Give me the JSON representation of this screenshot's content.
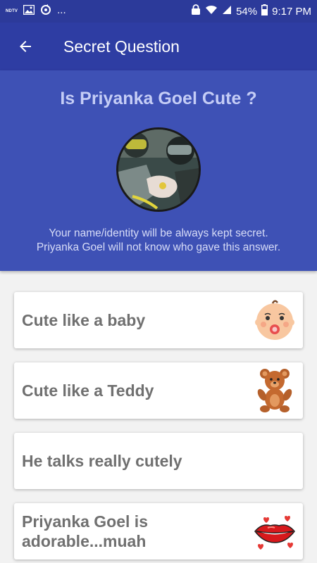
{
  "status_bar": {
    "left_icons": [
      "ndtv-icon",
      "image-icon",
      "sync-icon"
    ],
    "ndtv_label": "NDTV",
    "overflow": "...",
    "battery_percent": "54%",
    "time": "9:17 PM"
  },
  "header": {
    "title": "Secret Question"
  },
  "question": {
    "text": "Is Priyanka Goel Cute ?",
    "note_line1": "Your name/identity will be always kept secret.",
    "note_line2": "Priyanka Goel will not know who gave this answer."
  },
  "answers": [
    {
      "label": "Cute like a baby",
      "icon": "baby-emoji-icon"
    },
    {
      "label": "Cute like a Teddy",
      "icon": "teddy-bear-icon"
    },
    {
      "label": "He talks really cutely",
      "icon": ""
    },
    {
      "label": "Priyanka Goel is adorable...muah",
      "icon": "kiss-lips-icon"
    }
  ],
  "colors": {
    "status_bar": "#2c3a9a",
    "app_bar": "#2e3da3",
    "hero": "#3e51b5",
    "question_text": "#c5cdf6",
    "answer_text": "#707070"
  }
}
